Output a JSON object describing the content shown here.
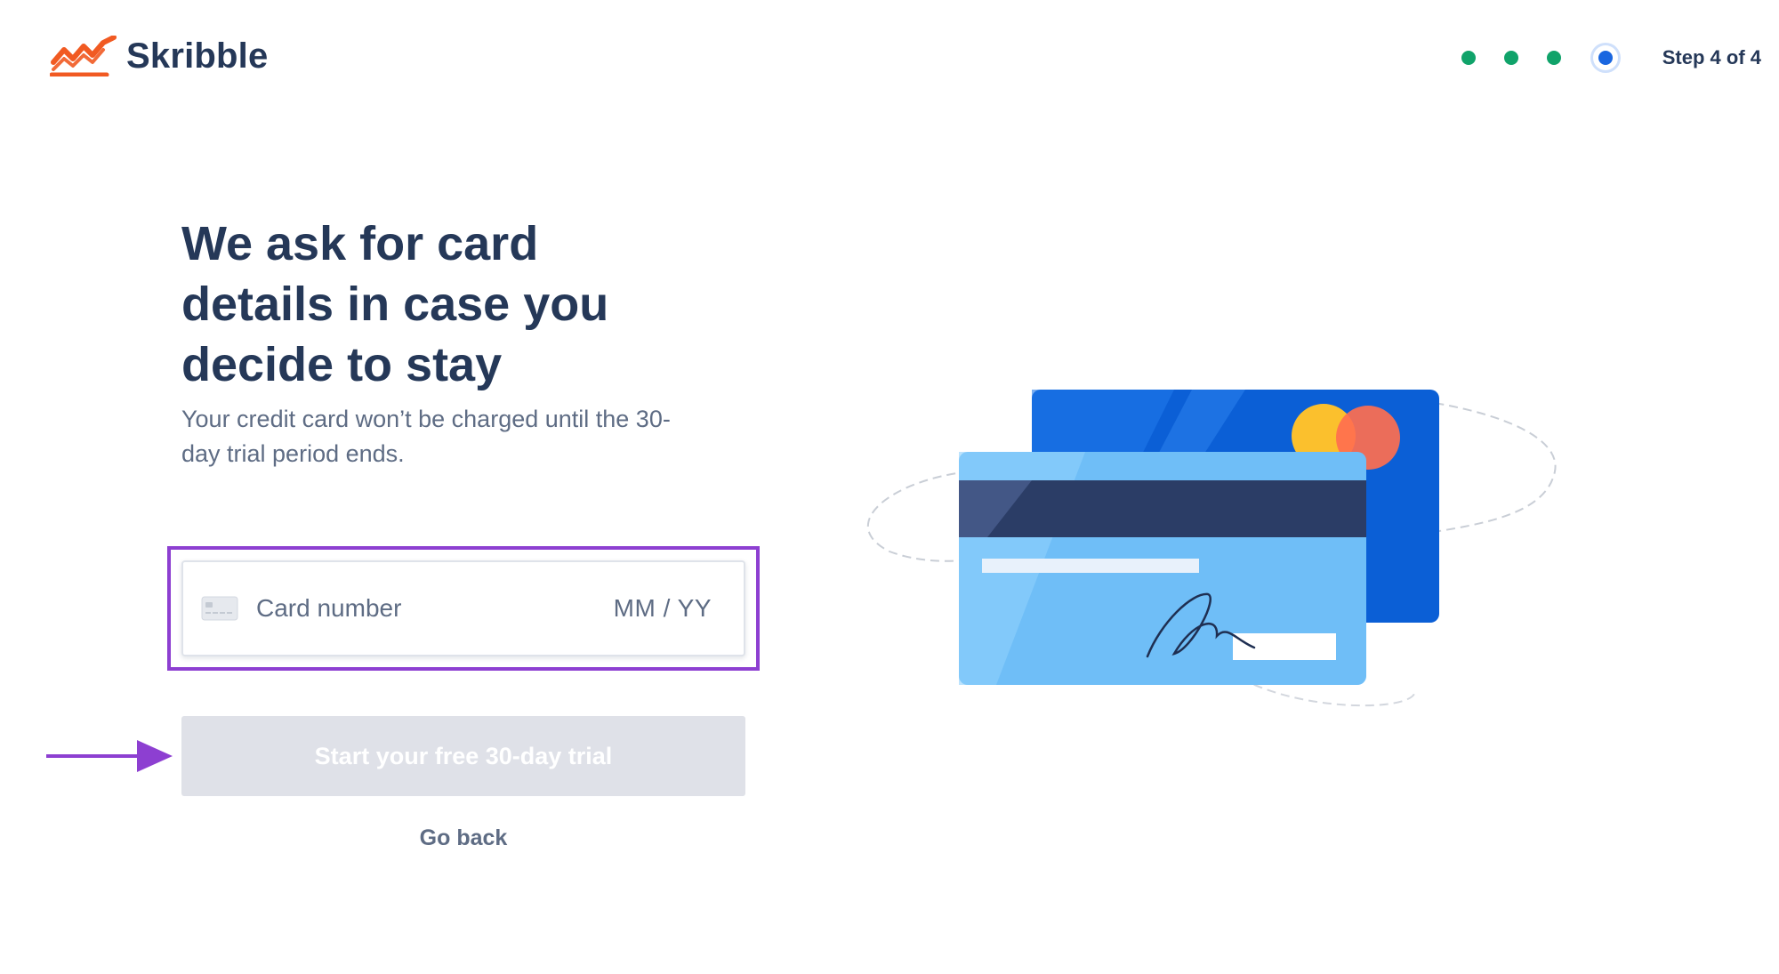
{
  "header": {
    "brand_name": "Skribble",
    "brand_color": "#f15a22",
    "step_label": "Step 4 of 4",
    "steps_total": 4,
    "step_current": 4,
    "step_done_color": "#10a36a",
    "step_current_color": "#1a66e0"
  },
  "main": {
    "headline": "We ask for card details in case you decide to stay",
    "subtext": "Your credit card won’t be charged until the 30-day trial period ends.",
    "card_field": {
      "card_number_placeholder": "Card number",
      "expiry_placeholder": "MM / YY",
      "icon": "credit-card-icon"
    },
    "submit_label": "Start your free 30-day trial",
    "back_label": "Go back"
  },
  "annotations": {
    "highlight_color": "#8d3fd1",
    "arrow_icon": "arrow-right-icon"
  },
  "illustration": {
    "name": "credit-cards-illustration"
  }
}
